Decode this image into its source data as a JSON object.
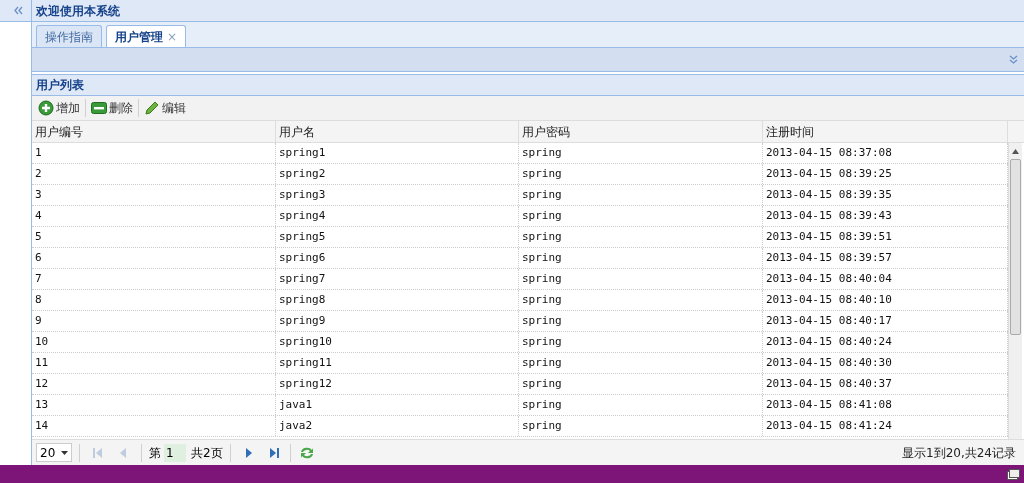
{
  "header": {
    "title": "欢迎使用本系统"
  },
  "tabs": [
    {
      "label": "操作指南",
      "selected": false
    },
    {
      "label": "用户管理",
      "selected": true,
      "close": "×"
    }
  ],
  "panel": {
    "title": "用户列表"
  },
  "toolbar": [
    {
      "kind": "add",
      "label": "增加"
    },
    {
      "kind": "remove",
      "label": "删除"
    },
    {
      "kind": "edit",
      "label": "编辑"
    }
  ],
  "table": {
    "columns": [
      "用户编号",
      "用户名",
      "用户密码",
      "注册时间"
    ],
    "rows": [
      [
        "1",
        "spring1",
        "spring",
        "2013-04-15 08:37:08"
      ],
      [
        "2",
        "spring2",
        "spring",
        "2013-04-15 08:39:25"
      ],
      [
        "3",
        "spring3",
        "spring",
        "2013-04-15 08:39:35"
      ],
      [
        "4",
        "spring4",
        "spring",
        "2013-04-15 08:39:43"
      ],
      [
        "5",
        "spring5",
        "spring",
        "2013-04-15 08:39:51"
      ],
      [
        "6",
        "spring6",
        "spring",
        "2013-04-15 08:39:57"
      ],
      [
        "7",
        "spring7",
        "spring",
        "2013-04-15 08:40:04"
      ],
      [
        "8",
        "spring8",
        "spring",
        "2013-04-15 08:40:10"
      ],
      [
        "9",
        "spring9",
        "spring",
        "2013-04-15 08:40:17"
      ],
      [
        "10",
        "spring10",
        "spring",
        "2013-04-15 08:40:24"
      ],
      [
        "11",
        "spring11",
        "spring",
        "2013-04-15 08:40:30"
      ],
      [
        "12",
        "spring12",
        "spring",
        "2013-04-15 08:40:37"
      ],
      [
        "13",
        "java1",
        "spring",
        "2013-04-15 08:41:08"
      ],
      [
        "14",
        "java2",
        "spring",
        "2013-04-15 08:41:24"
      ]
    ]
  },
  "pager": {
    "page_size": "20",
    "buttons_before": [
      {
        "kind": "first",
        "disabled": true
      },
      {
        "kind": "prev",
        "disabled": true
      }
    ],
    "page_prefix": "第",
    "page": "1",
    "page_suffix": "共2页",
    "buttons_after": [
      {
        "kind": "next",
        "disabled": false
      },
      {
        "kind": "last",
        "disabled": false
      },
      {
        "kind": "refresh",
        "disabled": false
      }
    ],
    "summary": "显示1到20,共24记录"
  }
}
